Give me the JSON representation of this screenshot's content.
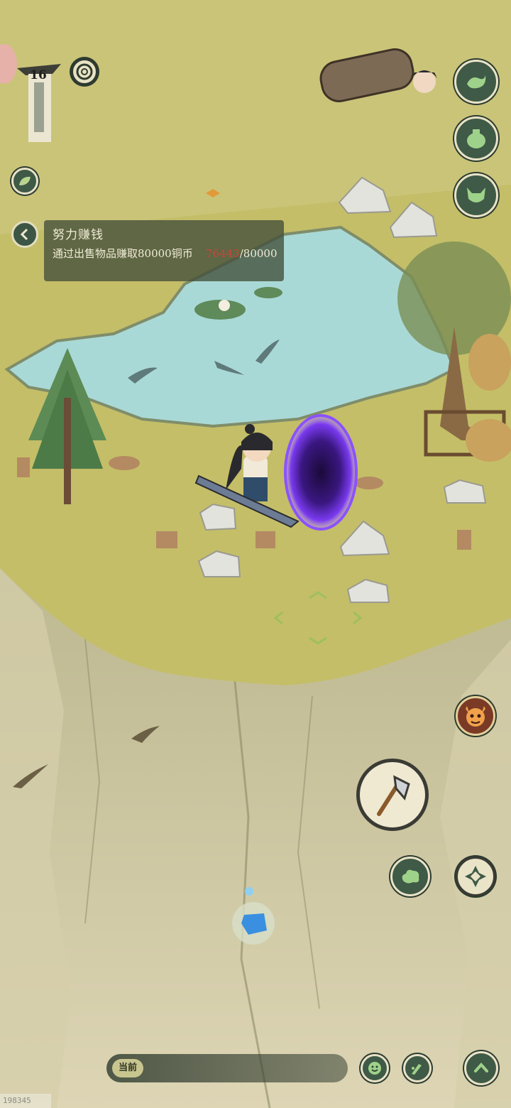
{
  "player": {
    "level": "16"
  },
  "quest": {
    "title": "努力赚钱",
    "description": "通过出售物品赚取80000铜币",
    "current": "76443",
    "separator_target": "/80000"
  },
  "chat": {
    "channel_tag": "当前"
  },
  "build_id": "198345",
  "colors": {
    "button_fill": "#3f5a46",
    "button_border": "#e9e3c8",
    "pond": "#a9d9d6",
    "grass": "#c8c26a",
    "portal": "#6b2fd8",
    "progress_current": "#c9453a"
  },
  "icons": {
    "right_column": [
      "wave-icon",
      "pot-icon",
      "monster-icon"
    ],
    "left_small": "leaf-icon",
    "top": "coin-ring-icon",
    "boss": "demon-face-icon",
    "action": "axe-icon",
    "skills": [
      "cloud-icon",
      "compass-star-icon"
    ],
    "bottom": [
      "smile-face-icon",
      "brush-icon",
      "up-arrow-icon"
    ]
  }
}
